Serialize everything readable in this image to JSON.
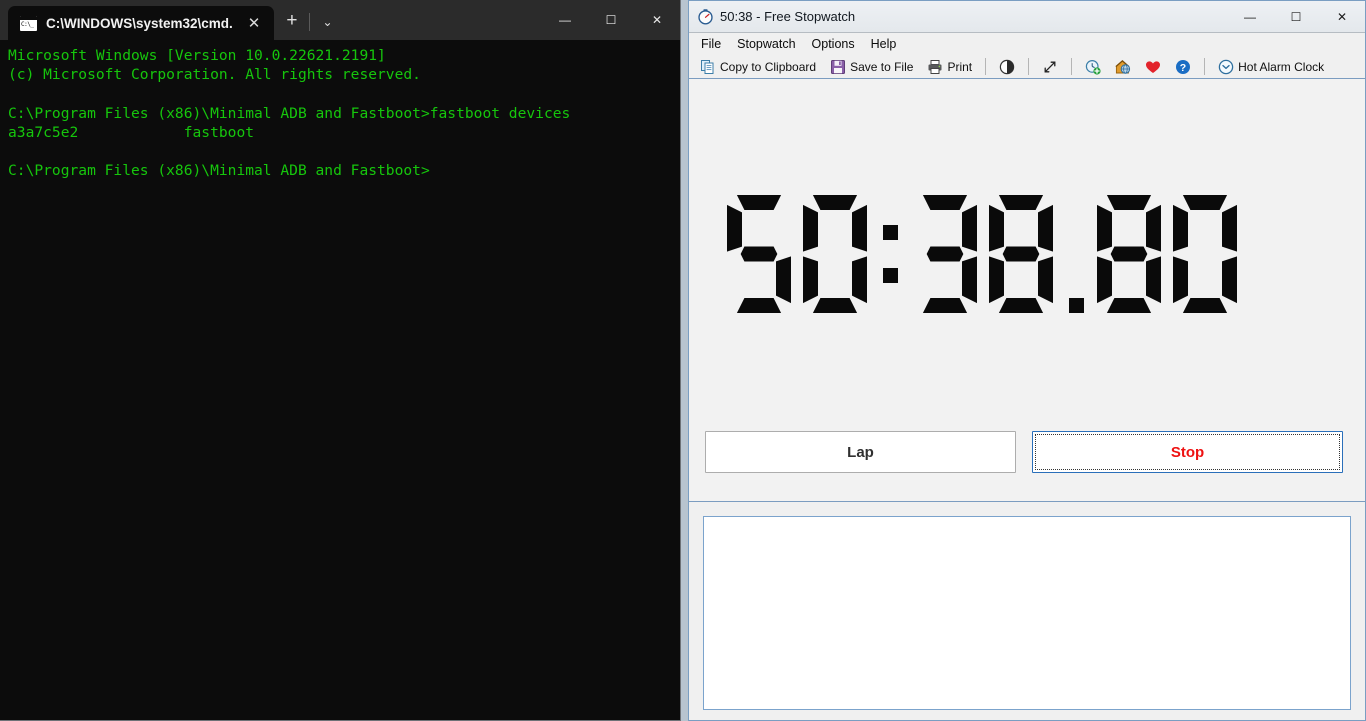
{
  "terminal": {
    "tab": {
      "title": "C:\\WINDOWS\\system32\\cmd.",
      "close_label": "✕",
      "icon": "cmd-console-icon"
    },
    "newtab_label": "+",
    "dropdown_label": "⌄",
    "window_controls": {
      "minimize": "—",
      "maximize": "☐",
      "close": "✕"
    },
    "lines": [
      "Microsoft Windows [Version 10.0.22621.2191]",
      "(c) Microsoft Corporation. All rights reserved.",
      "",
      "C:\\Program Files (x86)\\Minimal ADB and Fastboot>fastboot devices",
      "a3a7c5e2            fastboot",
      "",
      "C:\\Program Files (x86)\\Minimal ADB and Fastboot>"
    ],
    "text_color": "#16c60c",
    "background": "#0c0c0c"
  },
  "stopwatch": {
    "title": "50:38 - Free Stopwatch",
    "title_icon": "stopwatch-clock-icon",
    "window_controls": {
      "minimize": "—",
      "maximize": "☐",
      "close": "✕"
    },
    "menu": [
      {
        "label": "File",
        "name": "file"
      },
      {
        "label": "Stopwatch",
        "name": "stopwatch"
      },
      {
        "label": "Options",
        "name": "options"
      },
      {
        "label": "Help",
        "name": "help"
      }
    ],
    "toolbar": [
      {
        "label": "Copy to Clipboard",
        "icon": "copy-icon"
      },
      {
        "label": "Save to File",
        "icon": "save-floppy-icon"
      },
      {
        "label": "Print",
        "icon": "printer-icon"
      },
      {
        "label": "",
        "icon": "contrast-icon"
      },
      {
        "label": "",
        "icon": "expand-arrows-icon"
      },
      {
        "label": "",
        "icon": "clock-add-icon"
      },
      {
        "label": "",
        "icon": "home-globe-icon"
      },
      {
        "label": "",
        "icon": "heart-icon"
      },
      {
        "label": "",
        "icon": "help-question-icon"
      },
      {
        "label": "Hot Alarm Clock",
        "icon": "alarm-clock-icon"
      }
    ],
    "display": {
      "value": "50:38.80",
      "minutes": "50",
      "seconds": "38",
      "hundredths": "80",
      "segment_color": "#0a0a0a",
      "background": "#f2f2f2"
    },
    "buttons": [
      {
        "label": "Lap",
        "name": "lap-button",
        "focused": false
      },
      {
        "label": "Stop",
        "name": "stop-button",
        "focused": true
      }
    ],
    "lap_list": {
      "entries": [],
      "background": "#ffffff",
      "border_color": "#7ba3cc"
    },
    "accent_color": "#2a6fba",
    "stop_text_color": "#ee1111"
  }
}
